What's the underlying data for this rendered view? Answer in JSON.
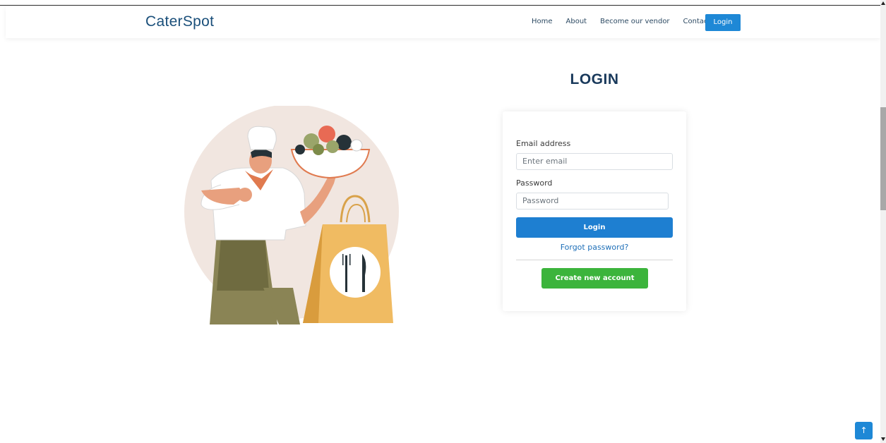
{
  "brand": "CaterSpot",
  "nav": {
    "links": [
      "Home",
      "About",
      "Become our vendor",
      "Contact"
    ],
    "login_button": "Login"
  },
  "page": {
    "title": "LOGIN"
  },
  "form": {
    "email_label": "Email address",
    "email_placeholder": "Enter email",
    "password_label": "Password",
    "password_placeholder": "Password",
    "submit_label": "Login",
    "forgot_link": "Forgot password?",
    "create_account_label": "Create new account"
  },
  "icons": {
    "back_to_top": "arrow-up-icon",
    "back_to_top_glyph": "↑",
    "illustration": "chef-with-salad-and-takeaway-bag"
  },
  "colors": {
    "brand": "#1a4f7a",
    "primary": "#1e88d6",
    "success": "#3cb43c",
    "title": "#1a3a5c"
  }
}
